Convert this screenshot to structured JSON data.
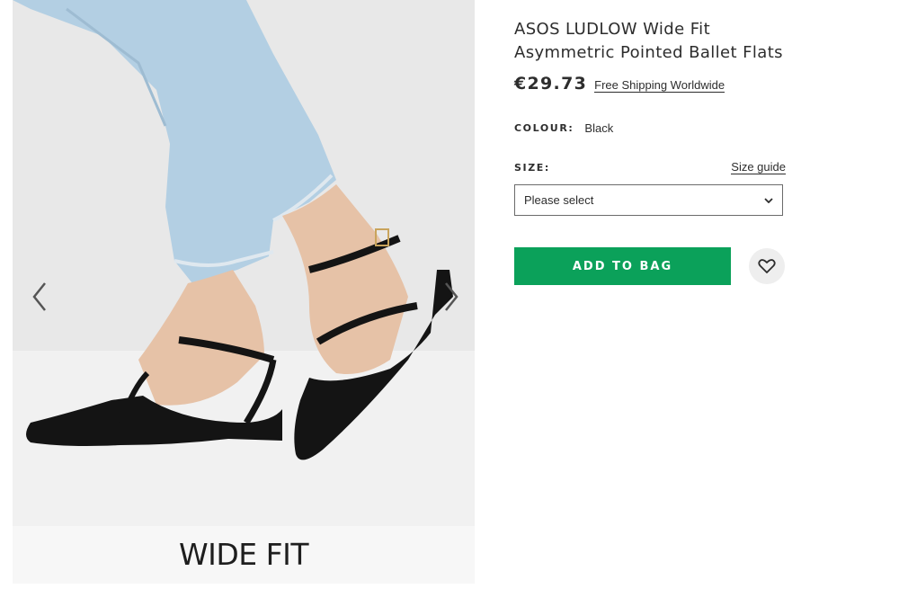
{
  "product": {
    "title": "ASOS LUDLOW Wide Fit Asymmetric Pointed Ballet Flats",
    "price": "€29.73",
    "shipping_link": "Free Shipping Worldwide",
    "colour_label": "COLOUR:",
    "colour_value": "Black",
    "size_label": "SIZE:",
    "size_guide": "Size guide",
    "size_select_value": "Please select",
    "add_to_bag": "ADD TO BAG"
  },
  "gallery": {
    "caption": "WIDE FIT",
    "prev_icon": "chevron-left-icon",
    "next_icon": "chevron-right-icon"
  },
  "colors": {
    "accent_green": "#0ba15a",
    "text": "#2d2d2d"
  }
}
